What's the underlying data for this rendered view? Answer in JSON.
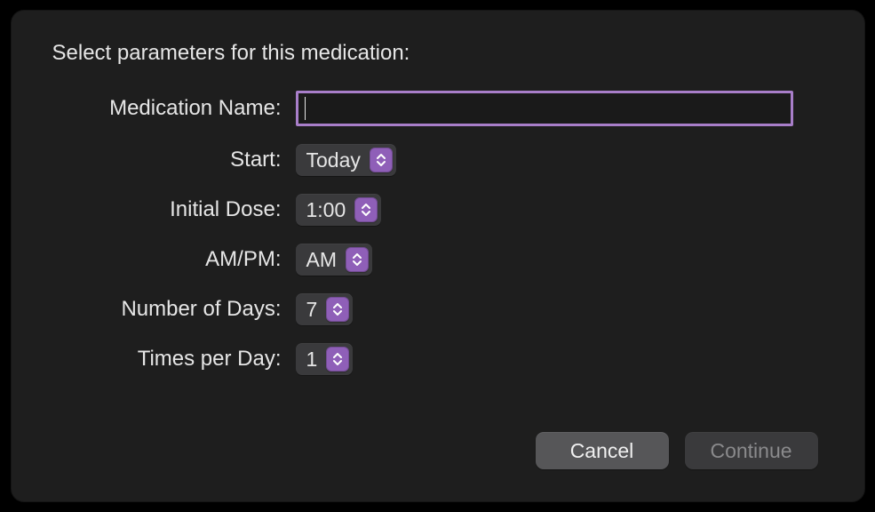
{
  "heading": "Select parameters for this medication:",
  "form": {
    "medicationName": {
      "label": "Medication Name:",
      "value": ""
    },
    "start": {
      "label": "Start:",
      "value": "Today"
    },
    "initialDose": {
      "label": "Initial Dose:",
      "value": "1:00"
    },
    "ampm": {
      "label": "AM/PM:",
      "value": "AM"
    },
    "numberOfDays": {
      "label": "Number of Days:",
      "value": "7"
    },
    "timesPerDay": {
      "label": "Times per Day:",
      "value": "1"
    }
  },
  "buttons": {
    "cancel": "Cancel",
    "continue": "Continue"
  },
  "colors": {
    "accent": "#8f5fb8",
    "focusRing": "#a87ec9",
    "dialogBg": "#1e1e1e",
    "controlBg": "#3a3a3c"
  }
}
